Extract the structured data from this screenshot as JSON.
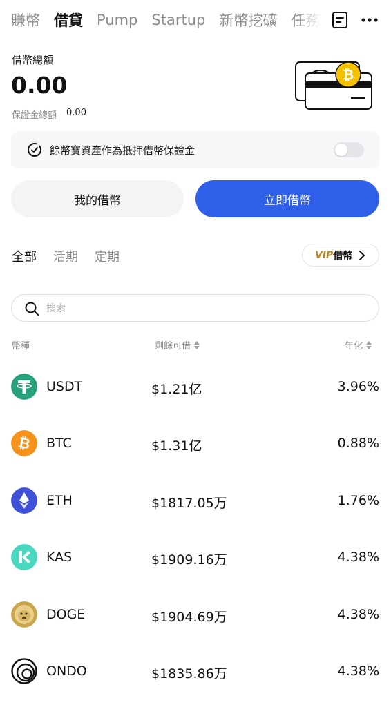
{
  "nav": {
    "tabs": [
      "賺幣",
      "借貸",
      "Pump",
      "Startup",
      "新幣挖礦",
      "任務匯"
    ],
    "active_index": 1
  },
  "summary": {
    "title": "借幣總額",
    "value": "0.00",
    "margin_label": "保證金總額",
    "margin_value": "0.00"
  },
  "collateral_toggle": {
    "label": "餘幣寶資產作為抵押借幣保證金",
    "enabled": false
  },
  "actions": {
    "my_loans": "我的借幣",
    "borrow_now": "立即借幣"
  },
  "filters": {
    "all": "全部",
    "flexible": "活期",
    "fixed": "定期",
    "active": "all"
  },
  "vip": {
    "mark": "VIP",
    "label": "借幣"
  },
  "search": {
    "placeholder": "搜索",
    "value": ""
  },
  "table": {
    "headers": {
      "coin": "幣種",
      "available": "剩餘可借",
      "apr": "年化"
    },
    "rows": [
      {
        "symbol": "USDT",
        "available": "$1.21亿",
        "apr": "3.96%",
        "icon": "usdt-icon",
        "color": "#26a17b"
      },
      {
        "symbol": "BTC",
        "available": "$1.31亿",
        "apr": "0.88%",
        "icon": "btc-icon",
        "color": "#f7931a"
      },
      {
        "symbol": "ETH",
        "available": "$1817.05万",
        "apr": "1.76%",
        "icon": "eth-icon",
        "color": "#3f51d9"
      },
      {
        "symbol": "KAS",
        "available": "$1909.16万",
        "apr": "4.38%",
        "icon": "kas-icon",
        "color": "#49d8c0"
      },
      {
        "symbol": "DOGE",
        "available": "$1904.69万",
        "apr": "4.38%",
        "icon": "doge-icon",
        "color": "#c9a64a"
      },
      {
        "symbol": "ONDO",
        "available": "$1835.86万",
        "apr": "4.38%",
        "icon": "ondo-icon",
        "color": "#111111"
      }
    ]
  },
  "colors": {
    "accent": "#2f5ee8",
    "vip_gold": "#b98a2c"
  }
}
